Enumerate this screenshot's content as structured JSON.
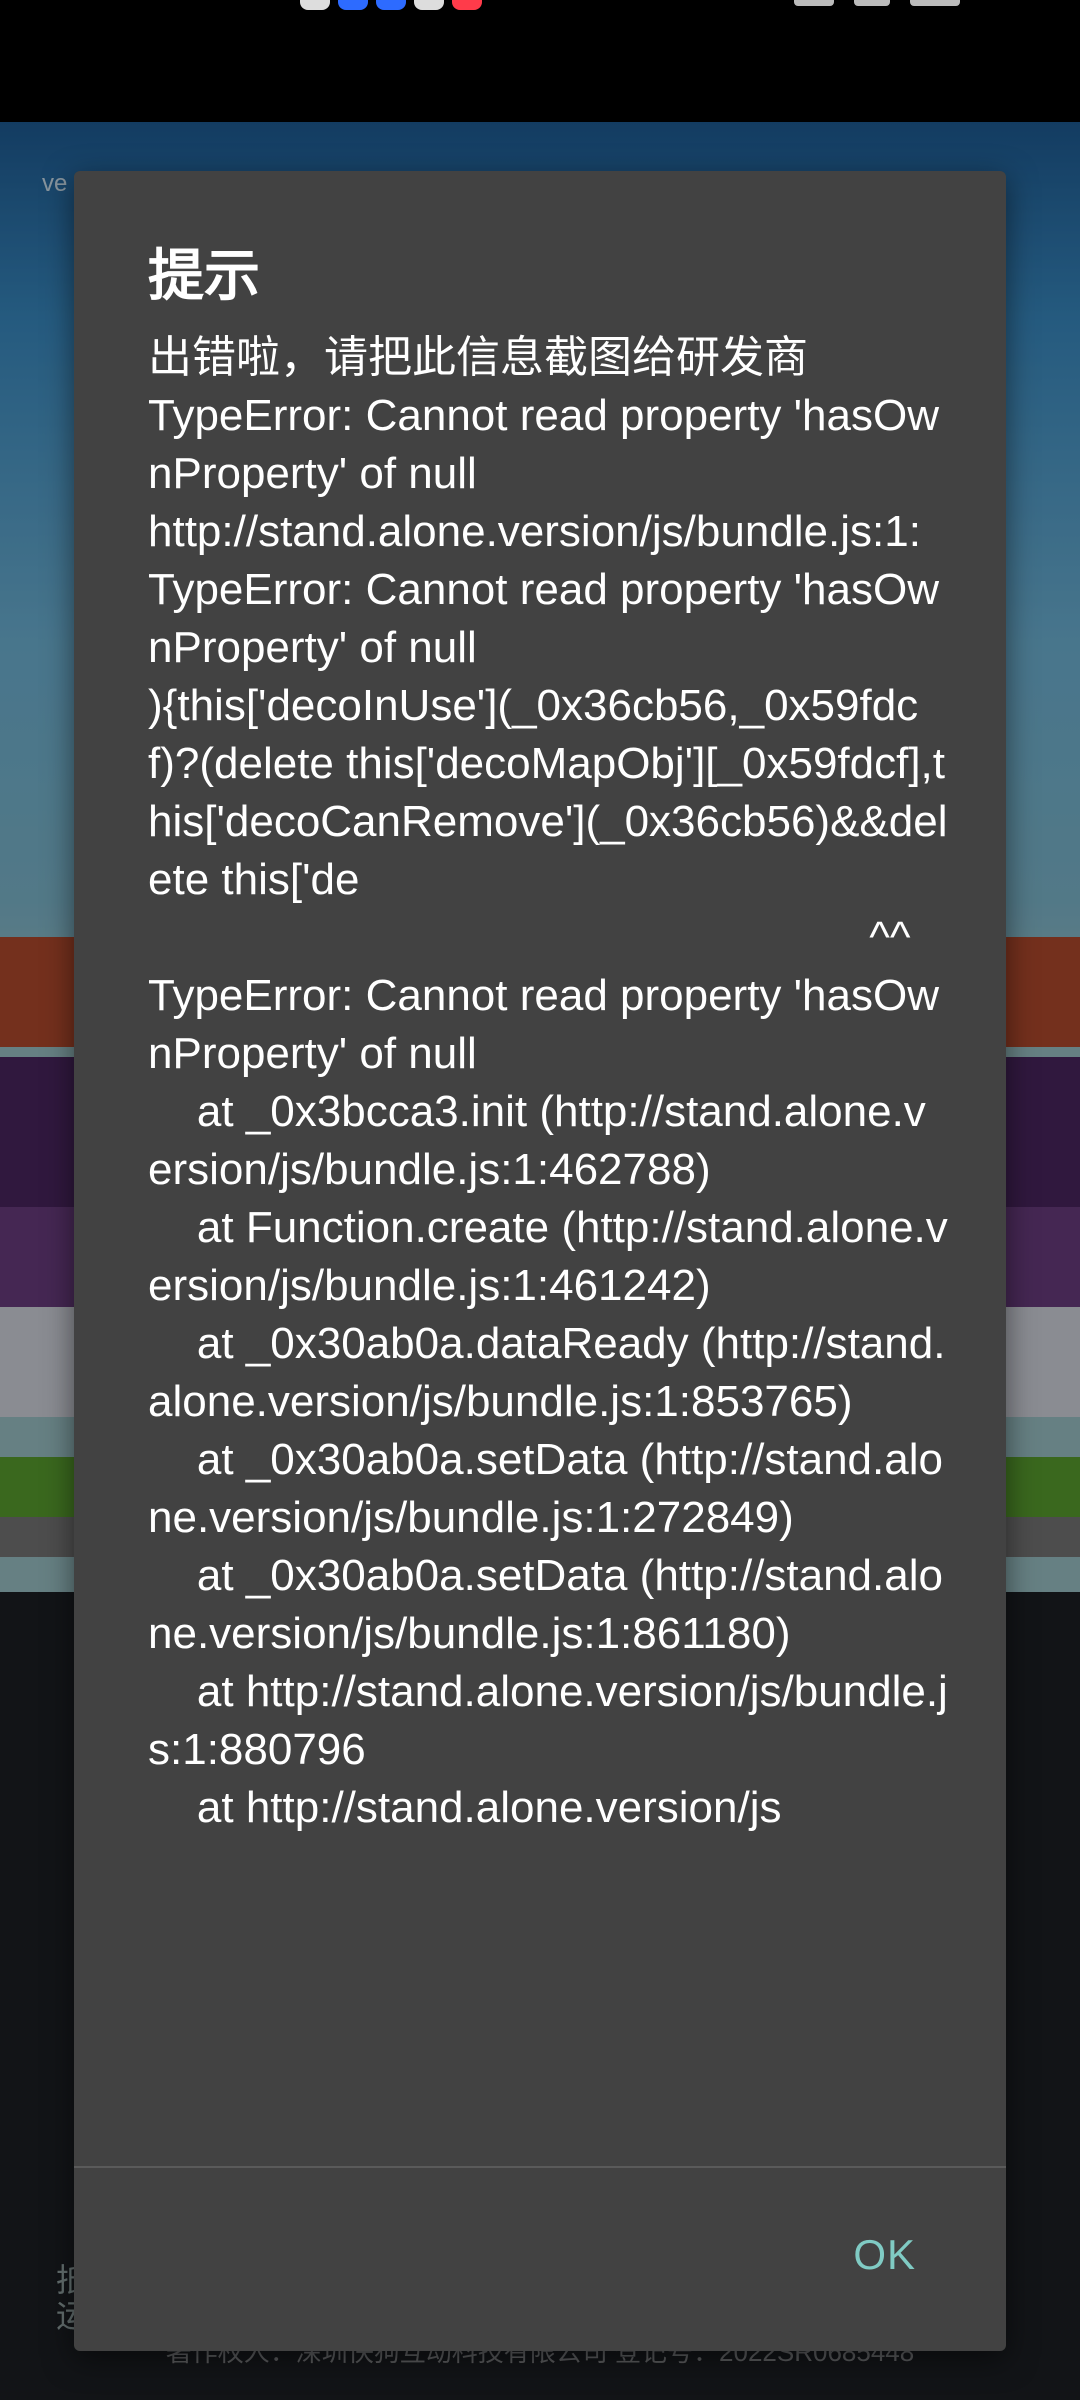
{
  "status_bar": {
    "accent_colors": [
      "#2d6bff",
      "#ff3b4a"
    ]
  },
  "background": {
    "version_tag": "ve",
    "bottom_left_line1": "抵",
    "bottom_left_line2": "运",
    "copyright": "著作权人：深圳快狗互动科技有限公司    登记号：2022SR0685448"
  },
  "dialog": {
    "title": "提示",
    "message": "出错啦，请把此信息截图给研发商\nTypeError: Cannot read property 'hasOwnProperty' of null\nhttp://stand.alone.version/js/bundle.js:1:\nTypeError: Cannot read property 'hasOwnProperty' of null\n){this['decoInUse'](_0x36cb56,_0x59fdcf)?(delete this['decoMapObj'][_0x59fdcf],this['decoCanRemove'](_0x36cb56)&&delete this['de\n                                                           ^^\nTypeError: Cannot read property 'hasOwnProperty' of null\n    at _0x3bcca3.init (http://stand.alone.version/js/bundle.js:1:462788)\n    at Function.create (http://stand.alone.version/js/bundle.js:1:461242)\n    at _0x30ab0a.dataReady (http://stand.alone.version/js/bundle.js:1:853765)\n    at _0x30ab0a.setData (http://stand.alone.version/js/bundle.js:1:272849)\n    at _0x30ab0a.setData (http://stand.alone.version/js/bundle.js:1:861180)\n    at http://stand.alone.version/js/bundle.js:1:880796\n    at http://stand.alone.version/js",
    "ok_label": "OK",
    "accent_color": "#80cbc4"
  }
}
